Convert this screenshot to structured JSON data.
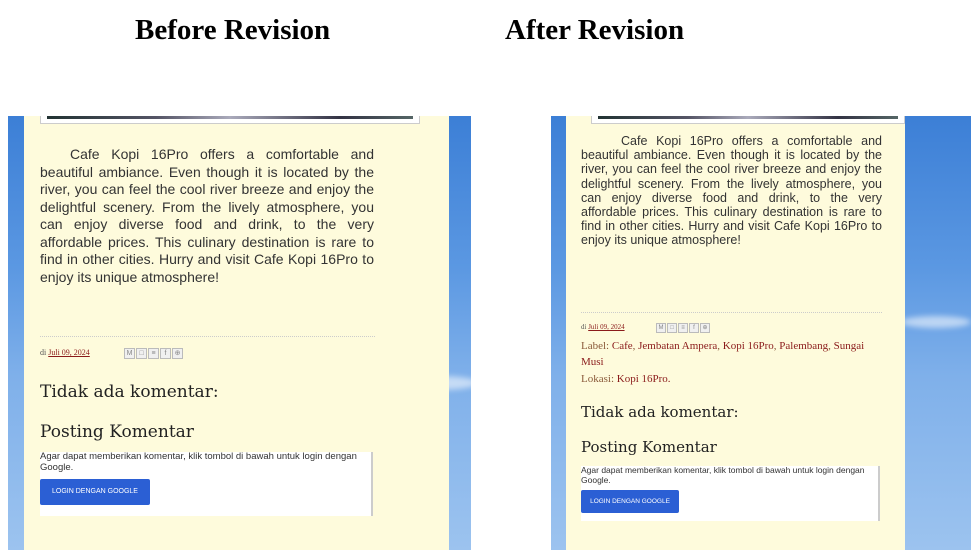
{
  "headings": {
    "before": "Before Revision",
    "after": "After Revision"
  },
  "post": {
    "body": "Cafe Kopi 16Pro offers a comfortable and beautiful ambiance. Even though it is located by the river, you can feel the cool river breeze and enjoy the delightful scenery. From the lively atmosphere, you can enjoy diverse food and drink, to the very affordable prices. This culinary destination is rare to find in other cities. Hurry and visit Cafe Kopi 16Pro to enjoy its unique atmosphere!",
    "posted_prefix": "di",
    "date": "Juli 09, 2024",
    "share_icons": [
      "M",
      "□",
      "≡",
      "f",
      "⊕"
    ],
    "labels_prefix": "Label:",
    "labels": [
      "Cafe",
      "Jembatan Ampera",
      "Kopi 16Pro",
      "Palembang",
      "Sungai Musi"
    ],
    "location_prefix": "Lokasi:",
    "location": "Kopi 16Pro."
  },
  "comments": {
    "no_comments": "Tidak ada komentar:",
    "post_comment": "Posting Komentar",
    "notice": "Agar dapat memberikan komentar, klik tombol di bawah untuk login dengan Google.",
    "login_button": "LOGIN DENGAN GOOGLE"
  }
}
